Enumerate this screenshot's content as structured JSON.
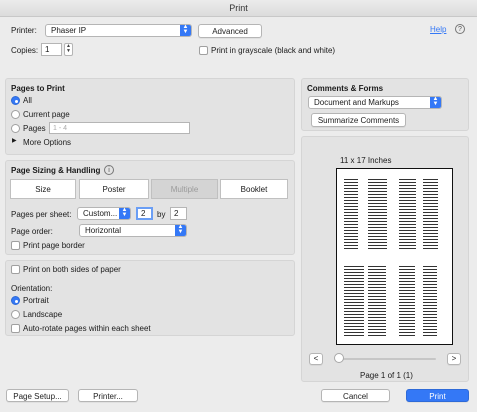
{
  "window": {
    "title": "Print"
  },
  "printer": {
    "label": "Printer:",
    "value": "Phaser IP",
    "advanced_label": "Advanced",
    "help_label": "Help"
  },
  "copies": {
    "label": "Copies:",
    "value": "1",
    "grayscale_label": "Print in grayscale (black and white)"
  },
  "pages_to_print": {
    "heading": "Pages to Print",
    "all_label": "All",
    "current_label": "Current page",
    "pages_label": "Pages",
    "pages_placeholder": "1 - 4",
    "more_label": "More Options"
  },
  "sizing": {
    "heading": "Page Sizing & Handling",
    "tabs": [
      "Size",
      "Poster",
      "Multiple",
      "Booklet"
    ],
    "pps_label": "Pages per sheet:",
    "pps_value": "Custom...",
    "cols": "2",
    "by_label": "by",
    "rows": "2",
    "order_label": "Page order:",
    "order_value": "Horizontal",
    "border_label": "Print page border"
  },
  "sides": {
    "both_label": "Print on both sides of paper"
  },
  "orientation": {
    "label": "Orientation:",
    "portrait_label": "Portrait",
    "landscape_label": "Landscape",
    "autorotate_label": "Auto-rotate pages within each sheet"
  },
  "comments": {
    "heading": "Comments & Forms",
    "value": "Document and Markups",
    "summarize_label": "Summarize Comments"
  },
  "preview": {
    "size_label": "11 x 17 Inches",
    "page_label": "Page 1 of 1 (1)",
    "prev": "<",
    "next": ">"
  },
  "footer": {
    "setup_label": "Page Setup...",
    "printer_label": "Printer...",
    "cancel_label": "Cancel",
    "print_label": "Print"
  },
  "colors": {
    "accent": "#3478f6"
  }
}
